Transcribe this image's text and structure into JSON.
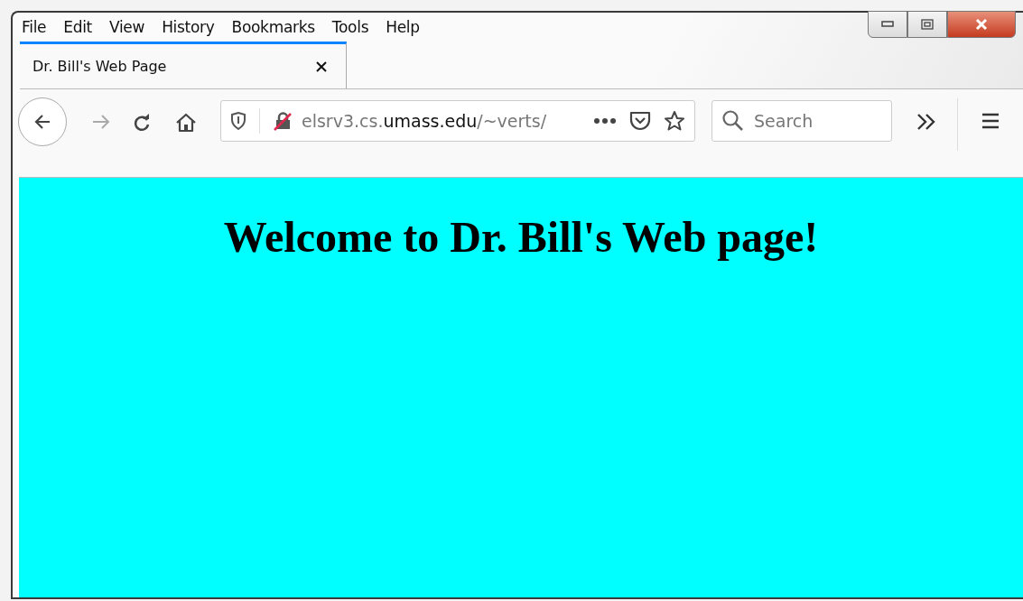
{
  "menu": [
    "File",
    "Edit",
    "View",
    "History",
    "Bookmarks",
    "Tools",
    "Help"
  ],
  "tabs": [
    {
      "title": "Dr. Bill's Web Page",
      "selected": true
    }
  ],
  "url": {
    "prefix": "elsrv3.cs.",
    "domain": "umass.edu",
    "suffix": "/~verts/"
  },
  "search": {
    "placeholder": "Search"
  },
  "page": {
    "heading": "Welcome to Dr. Bill's Web page!"
  }
}
